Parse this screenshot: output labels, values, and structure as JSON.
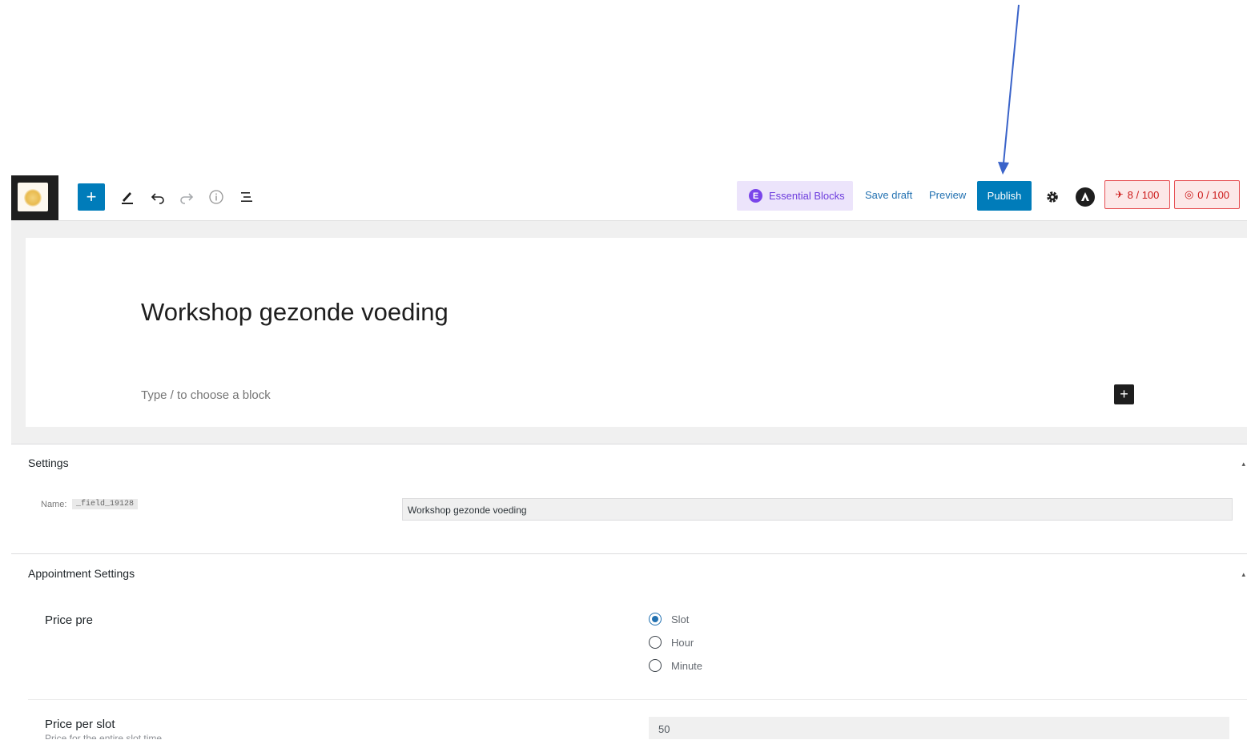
{
  "toolbar": {
    "essential_blocks_label": "Essential Blocks",
    "save_draft_label": "Save draft",
    "preview_label": "Preview",
    "publish_label": "Publish",
    "seo_score": "8 / 100",
    "readability_score": "0 / 100",
    "icons": [
      "plus-icon",
      "pencil-icon",
      "undo-icon",
      "redo-icon",
      "info-icon",
      "list-view-icon",
      "gear-icon",
      "astra-icon"
    ]
  },
  "editor": {
    "post_title": "Workshop gezonde voeding",
    "block_placeholder": "Type / to choose a block"
  },
  "settings": {
    "title": "Settings",
    "name_label": "Name:",
    "field_code": "_field_19128",
    "field_value": "Workshop gezonde voeding"
  },
  "appointment": {
    "title": "Appointment Settings",
    "price_pre_label": "Price pre",
    "options": [
      {
        "label": "Slot",
        "checked": true
      },
      {
        "label": "Hour",
        "checked": false
      },
      {
        "label": "Minute",
        "checked": false
      }
    ],
    "price_per_slot_label": "Price per slot",
    "price_per_slot_desc": "Price for the entire slot time",
    "price_per_slot_value": "50"
  },
  "colors": {
    "primary": "#007cba",
    "essential_bg": "#ece4fb",
    "score_red": "#cc1818",
    "annotation_arrow": "#3a63c9"
  }
}
